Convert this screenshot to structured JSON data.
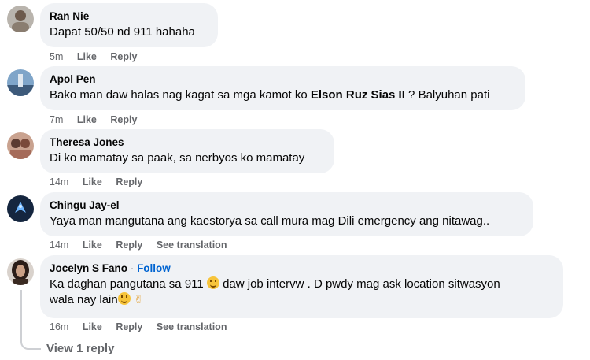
{
  "comments": [
    {
      "author": "Ran Nie",
      "text": "Dapat 50/50 nd 911 hahaha",
      "time": "5m",
      "like": "Like",
      "reply": "Reply"
    },
    {
      "author": "Apol Pen",
      "text_before": "Bako man daw halas nag kagat sa mga kamot ko ",
      "mention": "Elson Ruz Sias II",
      "text_after": " ? Balyuhan pati",
      "time": "7m",
      "like": "Like",
      "reply": "Reply"
    },
    {
      "author": "Theresa Jones",
      "text": "Di ko mamatay sa paak, sa nerbyos ko mamatay",
      "time": "14m",
      "like": "Like",
      "reply": "Reply"
    },
    {
      "author": "Chingu Jay-el",
      "text": "Yaya man mangutana ang kaestorya sa call mura mag Dili emergency ang nitawag..",
      "time": "14m",
      "like": "Like",
      "reply": "Reply",
      "translate": "See translation"
    },
    {
      "author": "Jocelyn S Fano",
      "separator": "·",
      "follow": "Follow",
      "text_line1_before": "Ka daghan pangutana sa 911 ",
      "text_line1_after": " daw job intervw . D pwdy mag ask location sitwasyon",
      "text_line2": "wala nay lain",
      "time": "16m",
      "like": "Like",
      "reply": "Reply",
      "translate": "See translation"
    }
  ],
  "view_replies": "View 1 reply",
  "icons": {
    "smile": "grinning-face-emoji",
    "peace": "victory-hand-emoji"
  }
}
